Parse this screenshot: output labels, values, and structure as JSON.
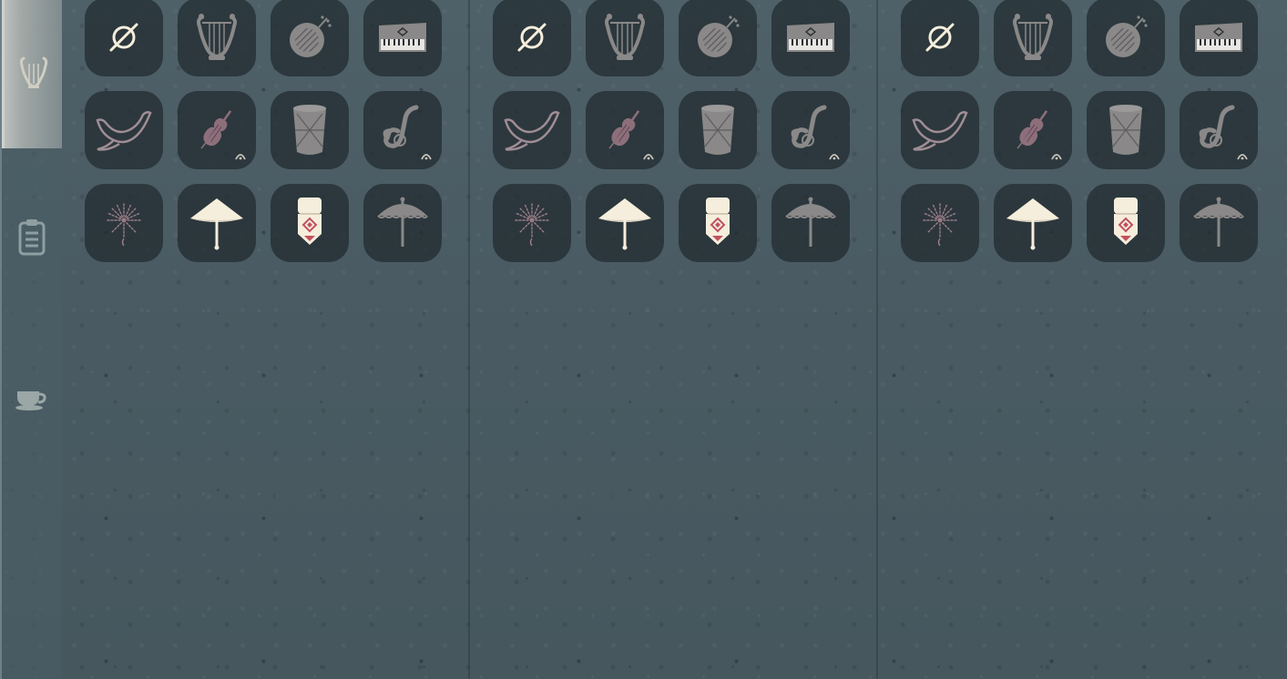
{
  "colors": {
    "background": "#4a5b63",
    "tile": "#202a2e",
    "icon_cream": "#f6eedc",
    "icon_grey": "#8a8888",
    "icon_mauve": "#8d6f7b",
    "accent_red": "#c0525e"
  },
  "sidebar": {
    "tabs": [
      {
        "icon": "lyre-icon",
        "active": true
      },
      {
        "icon": "clipboard-icon",
        "active": false
      },
      {
        "icon": "teacup-icon",
        "active": false
      }
    ]
  },
  "panels": [
    {
      "tiles": [
        {
          "icon": "none-icon",
          "selected": true
        },
        {
          "icon": "lyre-icon"
        },
        {
          "icon": "lute-icon"
        },
        {
          "icon": "keyboard-icon"
        },
        {
          "icon": "horn-icon"
        },
        {
          "icon": "violin-icon",
          "badge": true
        },
        {
          "icon": "drum-icon"
        },
        {
          "icon": "saxophone-icon",
          "badge": true
        },
        {
          "icon": "firework-icon"
        },
        {
          "icon": "conical-hat-icon",
          "selected": true
        },
        {
          "icon": "lantern-charm-icon",
          "selected": true
        },
        {
          "icon": "parasol-icon"
        }
      ]
    },
    {
      "tiles": [
        {
          "icon": "none-icon",
          "selected": true
        },
        {
          "icon": "lyre-icon"
        },
        {
          "icon": "lute-icon"
        },
        {
          "icon": "keyboard-icon"
        },
        {
          "icon": "horn-icon"
        },
        {
          "icon": "violin-icon",
          "badge": true
        },
        {
          "icon": "drum-icon"
        },
        {
          "icon": "saxophone-icon",
          "badge": true
        },
        {
          "icon": "firework-icon"
        },
        {
          "icon": "conical-hat-icon",
          "selected": true
        },
        {
          "icon": "lantern-charm-icon",
          "selected": true
        },
        {
          "icon": "parasol-icon"
        }
      ]
    },
    {
      "tiles": [
        {
          "icon": "none-icon",
          "selected": true
        },
        {
          "icon": "lyre-icon"
        },
        {
          "icon": "lute-icon"
        },
        {
          "icon": "keyboard-icon"
        },
        {
          "icon": "horn-icon"
        },
        {
          "icon": "violin-icon",
          "badge": true
        },
        {
          "icon": "drum-icon"
        },
        {
          "icon": "saxophone-icon",
          "badge": true
        },
        {
          "icon": "firework-icon"
        },
        {
          "icon": "conical-hat-icon",
          "selected": true
        },
        {
          "icon": "lantern-charm-icon",
          "selected": true
        },
        {
          "icon": "parasol-icon"
        }
      ]
    }
  ]
}
